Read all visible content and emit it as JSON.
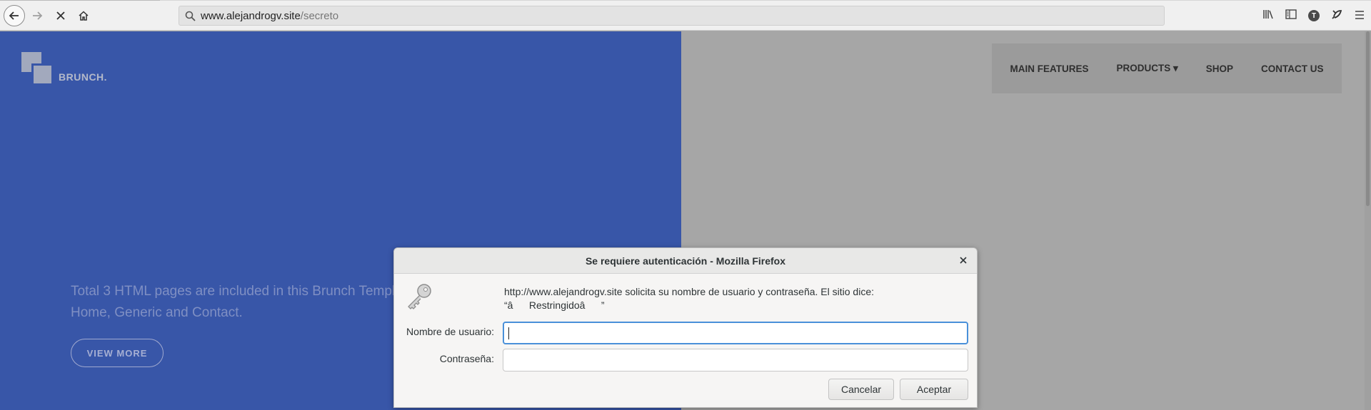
{
  "browser": {
    "url_host": "www.alejandrogv.site",
    "url_path": "/secreto",
    "profile_initial": "T"
  },
  "site": {
    "logo_text": "BRUNCH.",
    "nav": [
      "MAIN FEATURES",
      "PRODUCTS ▾",
      "SHOP",
      "CONTACT US"
    ],
    "hero_text": "Total 3 HTML pages are included in this Brunch Template: Home, Generic and Contact.",
    "view_more": "VIEW MORE",
    "hero_color": "#3856a8"
  },
  "dialog": {
    "title": "Se requiere autenticación - Mozilla Firefox",
    "message_line1": "http://www.alejandrogv.site solicita su nombre de usuario y contraseña. El sitio dice:",
    "message_line2": "“âRestringidoâ”",
    "username_label": "Nombre de usuario:",
    "password_label": "Contraseña:",
    "username_value": "",
    "password_value": "",
    "cancel": "Cancelar",
    "accept": "Aceptar"
  }
}
